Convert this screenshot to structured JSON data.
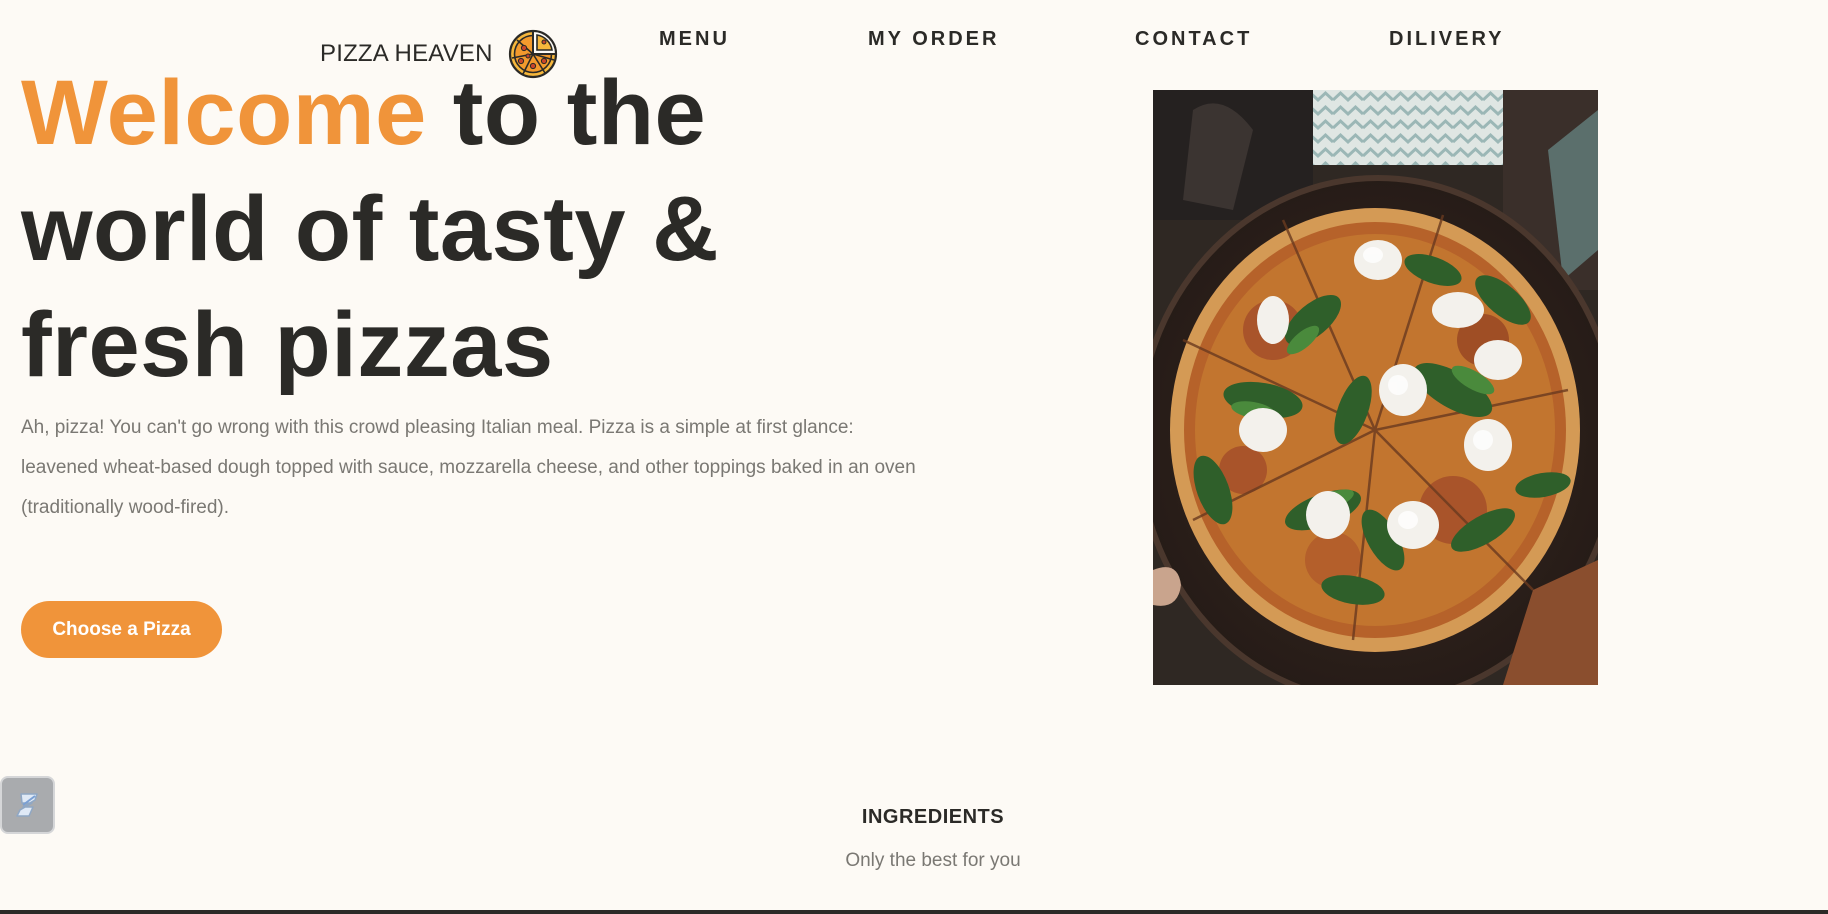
{
  "header": {
    "brand_name": "PIZZA HEAVEN",
    "logo_icon": "pizza-icon",
    "nav": [
      {
        "label": "MENU"
      },
      {
        "label": "MY ORDER"
      },
      {
        "label": "CONTACT"
      },
      {
        "label": "DILIVERY"
      }
    ]
  },
  "hero": {
    "title_accent": "Welcome",
    "title_rest": " to the world of tasty & fresh pizzas",
    "description": "Ah, pizza! You can't go wrong with this crowd pleasing Italian meal. Pizza is a simple at first glance: leavened wheat-based dough topped with sauce, mozzarella cheese, and other toppings baked in an oven (traditionally wood-fired).",
    "cta_label": "Choose a Pizza",
    "image_subject": "pizza-photo"
  },
  "widget": {
    "icon": "extension-icon"
  },
  "ingredients": {
    "title": "INGREDIENTS",
    "subtitle": "Only the best for you"
  },
  "colors": {
    "accent": "#f0943a",
    "text": "#2b2a27",
    "muted": "#7a7873",
    "background": "#fdfaf5"
  }
}
